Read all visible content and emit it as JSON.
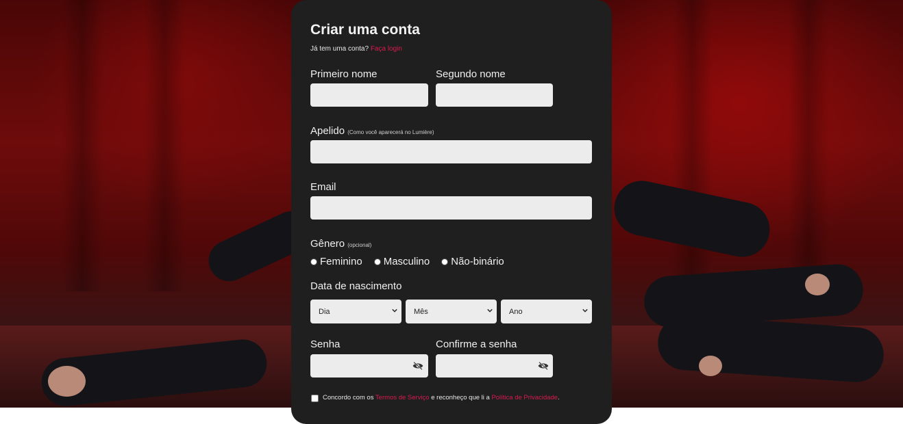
{
  "form": {
    "title": "Criar uma conta",
    "have_account": "Já tem uma conta?",
    "login_link": "Faça login",
    "first_name_label": "Primeiro nome",
    "last_name_label": "Segundo nome",
    "nickname_label": "Apelido",
    "nickname_hint": "(Como você aparecerá no Lumière)",
    "email_label": "Email",
    "gender_label": "Gênero",
    "gender_hint": "(opcional)",
    "gender_options": [
      "Feminino",
      "Masculino",
      "Não-binário"
    ],
    "birth_label": "Data de nascimento",
    "birth_day": "Dia",
    "birth_month": "Mês",
    "birth_year": "Ano",
    "password_label": "Senha",
    "confirm_password_label": "Confirme a senha",
    "terms_prefix": "Concordo com os",
    "terms_link": "Termos de Serviço",
    "terms_middle": "e reconheço que li a",
    "privacy_link": "Política de Privacidade",
    "terms_suffix": "."
  },
  "colors": {
    "accent": "#d81b50",
    "card_bg": "#1f1f1f",
    "input_bg": "#ececec"
  },
  "icons": {
    "password_toggle": "eye-slash-icon",
    "select_arrow": "chevron-down-icon"
  }
}
